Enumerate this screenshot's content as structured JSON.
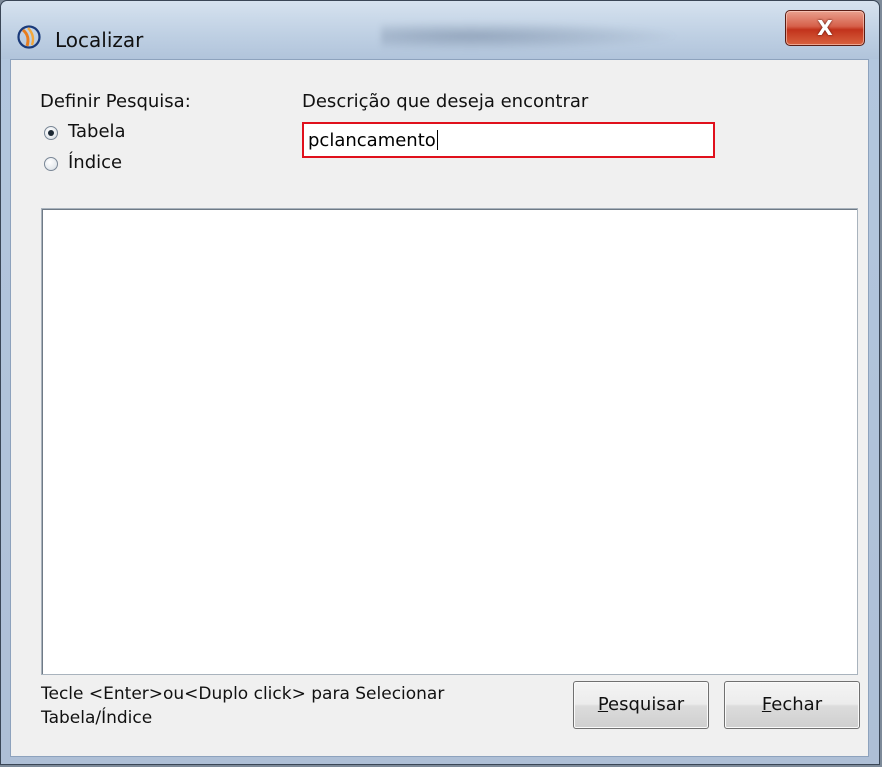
{
  "window": {
    "title": "Localizar",
    "close_label": "X"
  },
  "search_scope": {
    "label": "Definir Pesquisa:",
    "options": [
      {
        "label": "Tabela",
        "checked": true
      },
      {
        "label": "Índice",
        "checked": false
      }
    ]
  },
  "search": {
    "label": "Descrição que deseja encontrar",
    "value": "pclancamento"
  },
  "results": {
    "items": []
  },
  "footer": {
    "hint_line1": "Tecle <Enter>ou<Duplo click> para Selecionar",
    "hint_line2": "Tabela/Índice"
  },
  "buttons": {
    "search": {
      "first_letter": "P",
      "rest": "esquisar"
    },
    "close": {
      "first_letter": "F",
      "rest": "echar"
    }
  },
  "icons": {
    "app": "app-logo-icon",
    "radio": "radio-button-icon"
  },
  "colors": {
    "highlight_border": "#e0101c",
    "close_button": "#c2331c"
  }
}
